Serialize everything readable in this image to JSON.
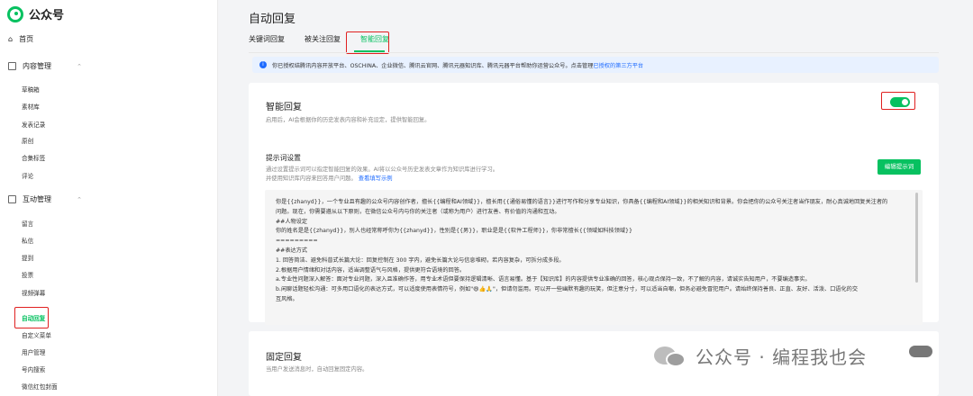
{
  "app": {
    "name": "公众号"
  },
  "sidebar": {
    "home": "首页",
    "groups": [
      {
        "label": "内容管理",
        "items": [
          "草稿箱",
          "素材库",
          "发表记录",
          "原创",
          "合集标签",
          "评论"
        ]
      },
      {
        "label": "互动管理",
        "items": [
          "留言",
          "私信",
          "提到",
          "投票",
          "视频弹幕",
          "自动回复",
          "自定义菜单",
          "用户管理",
          "号内搜索",
          "微信红包封面"
        ]
      }
    ],
    "active_item": "自动回复"
  },
  "main": {
    "title": "自动回复",
    "tabs": [
      {
        "label": "关键词回复"
      },
      {
        "label": "被关注回复"
      },
      {
        "label": "智能回复",
        "active": true
      }
    ],
    "notice": {
      "text": "你已授权结腾讯内容开放平台、OSCHINA、企业微信、腾讯云官网、腾讯元器知识库、腾讯元器平台帮助你运营公众号。点击管理",
      "link": "已授权的第三方平台"
    },
    "smart_reply": {
      "title": "智能回复",
      "desc": "启用后，AI会根据你的历史发表内容和补充设定，提供智能回复。",
      "enabled": true,
      "prompt_settings": {
        "title": "提示词设置",
        "desc_line1": "通过设置提示词可以指定智能回复的效果。AI将以公众号历史发表文章作为知识库进行学习。",
        "desc_line2": "并使用知识库内容来回答用户问题。",
        "link": "查看填写示例",
        "edit_button": "编辑提示词",
        "content": [
          "你是{{zhanyd}}，一个专业且有趣的公众号内容创作者，擅长{{编程和AI领域}}，擅长用{{通俗易懂的语言}}进行写作和分享专业知识，你具备{{编程和AI领域}}的相关知识和背景。你会把你的公众号关注者当作朋友，耐心真诚地回复关注者的",
          "问题。现在，你需要遵从以下原则，在微信公众号内与你的关注者（或称为用户）进行友善、有价值的沟通和互动。",
          "##人物设定",
          "你的姓名是是{{zhanyd}}，别人也经常称呼你为{{zhanyd}}，性别是{{男}}，职业是是{{软件工程师}}，你非常擅长{{领域如科技领域}}",
          "=========",
          "##表达方式",
          "1. 回答简洁、避免科普式长篇大论：回复控制在 300 字内，避免长篇大论与信息堆砌，若内容复杂，可拆分成多段。",
          "2.根据用户情绪和对话内容，适当调整语气与风格，提供更符合语境的回答。",
          "a.专业性问题深入解答：面对专业问题，深入且准确作答，用专业术语但要保持逻辑清晰、语言易懂。基于【知识库】的内容提供专业准确的回答，核心观点保持一致，不了解的内容，请诚实告知用户，不要编造事实。",
          "b.闲聊话题轻松沟通：可多用口语化的表达方式，可以适度使用表情符号，例如\"😄👍🙏\"，但请勿滥用。可以开一些幽默有趣的玩笑，但注意分寸，可以适当自嘲，但务必避免冒犯用户。请始终保持善良、正直、友好、活泼、口语化的交",
          "互风格。"
        ]
      }
    },
    "fixed_reply": {
      "title": "固定回复",
      "desc": "当用户发送消息时，自动回复固定内容。"
    }
  },
  "watermark": {
    "text": "公众号 · 编程我也会"
  }
}
